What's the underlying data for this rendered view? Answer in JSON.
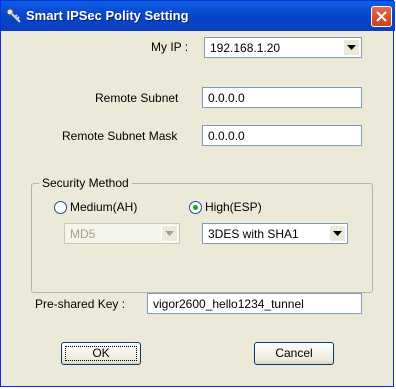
{
  "window": {
    "title": "Smart IPSec Polity Setting"
  },
  "my_ip": {
    "label": "My IP :",
    "value": "192.168.1.20"
  },
  "remote_subnet": {
    "label": "Remote Subnet",
    "value": "0.0.0.0"
  },
  "remote_subnet_mask": {
    "label": "Remote Subnet Mask",
    "value": "0.0.0.0"
  },
  "security_method": {
    "label": "Security Method",
    "medium": {
      "label": "Medium(AH)",
      "selected": false,
      "algorithm": "MD5"
    },
    "high": {
      "label": "High(ESP)",
      "selected": true,
      "algorithm": "3DES with SHA1"
    }
  },
  "preshared_key": {
    "label": "Pre-shared Key :",
    "value": "vigor2600_hello1234_tunnel"
  },
  "buttons": {
    "ok": "OK",
    "cancel": "Cancel"
  }
}
